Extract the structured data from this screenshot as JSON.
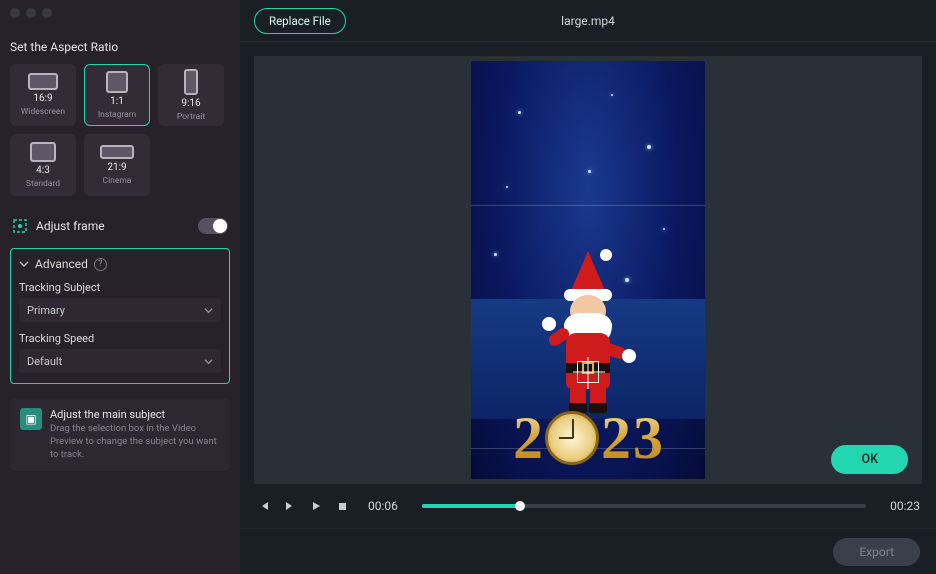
{
  "titlebar": {
    "filename": "large.mp4"
  },
  "header": {
    "replace_label": "Replace File"
  },
  "sidebar": {
    "title": "Set the Aspect Ratio",
    "ratios": [
      {
        "ratio": "16:9",
        "name": "Widescreen"
      },
      {
        "ratio": "1:1",
        "name": "Instagram"
      },
      {
        "ratio": "9:16",
        "name": "Portrait"
      },
      {
        "ratio": "4:3",
        "name": "Standard"
      },
      {
        "ratio": "21:9",
        "name": "Cinema"
      }
    ],
    "adjust_frame_label": "Adjust frame",
    "adjust_frame_on": true,
    "advanced": {
      "label": "Advanced",
      "tracking_subject_label": "Tracking Subject",
      "tracking_subject_value": "Primary",
      "tracking_speed_label": "Tracking Speed",
      "tracking_speed_value": "Default"
    },
    "tip": {
      "title": "Adjust the main subject",
      "body": "Drag the selection box in the Video Preview to change the subject you want to track."
    }
  },
  "preview": {
    "ok_label": "OK",
    "year_digits": [
      "2",
      "0",
      "2",
      "3"
    ]
  },
  "controls": {
    "current_time": "00:06",
    "duration": "00:23",
    "progress_pct": 22
  },
  "footer": {
    "export_label": "Export"
  },
  "colors": {
    "accent": "#23d6b0"
  }
}
